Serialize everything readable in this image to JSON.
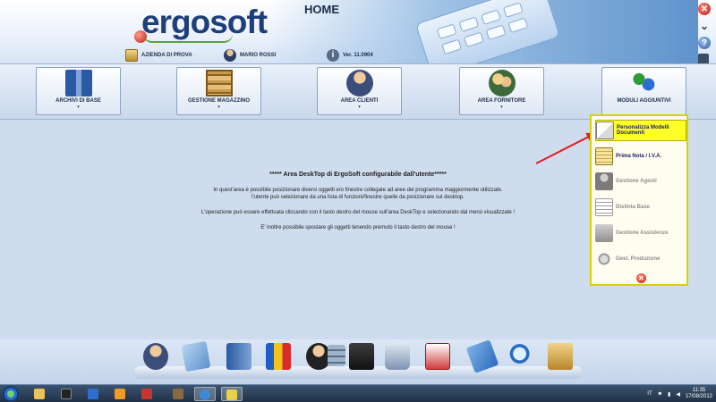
{
  "header": {
    "logo_prefix": "ergo",
    "logo_suffix": "soft",
    "title": "HOME",
    "company": "AZIENDA DI PROVA",
    "user": "MARIO ROSSI",
    "version": "Ver. 11.0904"
  },
  "window_controls": {
    "close": "✕",
    "minimize": "⌄",
    "help": "?",
    "calculator": ""
  },
  "menu": {
    "items": [
      {
        "label": "ARCHIVI DI BASE",
        "icon": "server-icon",
        "arrow": "▾"
      },
      {
        "label": "GESTIONE MAGAZZINO",
        "icon": "shelf-icon",
        "arrow": "▾"
      },
      {
        "label": "AREA CLIENTI",
        "icon": "client-icon",
        "arrow": "▾"
      },
      {
        "label": "AREA FORNITORE",
        "icon": "supplier-icon",
        "arrow": "▾"
      },
      {
        "label": "MODULI AGGIUNTIVI",
        "icon": "puzzle-icon",
        "arrow": ""
      }
    ]
  },
  "desktop": {
    "title": "***** Area DeskTop di ErgoSoft configurabile dall'utente*****",
    "p1": "In   quest'area è possibile  posizionare diversi  oggetti e/o  finestre collegate ad aree del programma maggiormente utilizzate.\nl'utente  può selezionare  da  una lista di funzioni/finestre quelle da posizionare sul desktop.",
    "p2": "L'operazione può essere effettuata  cliccando con il  tasto destro del mouse sull'area DeskTop e selezionando dal menù visualizzate !",
    "p3": "E' inoltre possibile spostare   gli oggetti   tenendo premuto il tasto destro del mouse !"
  },
  "panel": {
    "items": [
      {
        "label": "Personalizza Modelli Documenti",
        "state": "highlighted",
        "icon": "document-icon"
      },
      {
        "label": "Prima Nota / I.V.A.",
        "state": "active",
        "icon": "notebook-icon"
      },
      {
        "label": "Gestione Agenti",
        "state": "disabled",
        "icon": "agent-icon"
      },
      {
        "label": "Distinta Base",
        "state": "disabled",
        "icon": "list-icon"
      },
      {
        "label": "Gestione Assistenze",
        "state": "disabled",
        "icon": "assistance-icon"
      },
      {
        "label": "Gest. Produzione",
        "state": "disabled",
        "icon": "gears-icon"
      }
    ],
    "close": "✕"
  },
  "dock": {
    "icons": [
      "operator-icon",
      "map-icon",
      "binder-icon",
      "chart-icon",
      "security-guard-icon",
      "database-lock-icon",
      "floppy-icon",
      "printer-icon",
      "calendar-icon",
      "tag-icon",
      "search-icon",
      "toolbox-icon"
    ]
  },
  "taskbar": {
    "language": "IT",
    "time": "11:35",
    "date": "17/08/2012"
  },
  "colors": {
    "panel_border": "#d8d300",
    "highlight": "#ffff2a",
    "arrow": "#e21b1b"
  }
}
